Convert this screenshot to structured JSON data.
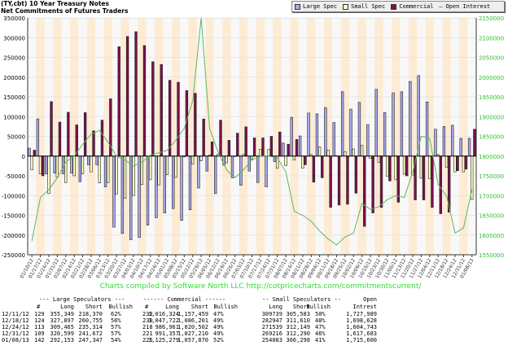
{
  "header": {
    "title": "(TY,cbt) 10 Year Treasury Notes",
    "subtitle": "Net Commitments of Futures Traders"
  },
  "legend": [
    {
      "label": "Large Spec",
      "color": "#aaaaee"
    },
    {
      "label": "Small Spec",
      "color": "#ffffc4"
    },
    {
      "label": "Commercial",
      "color": "#7a1050"
    },
    {
      "label": "Open Interest",
      "color": "#5cb85c"
    }
  ],
  "credit": "Charts compiled by Software North LLC  http://cotpricecharts.com/commitmentscurrent/",
  "chart_data": {
    "type": "bar",
    "title": "(TY,cbt) 10 Year Treasury Notes",
    "left_ylim": [
      -250000,
      350000
    ],
    "right_ylim": [
      1550000,
      2150000
    ],
    "left_ticks": [
      "350000",
      "300000",
      "250000",
      "200000",
      "150000",
      "100000",
      "50000",
      "0",
      "-50000",
      "-100000",
      "-150000",
      "-200000",
      "-250000"
    ],
    "right_ticks": [
      "2150000",
      "2100000",
      "2050000",
      "2000000",
      "1950000",
      "1900000",
      "1850000",
      "1800000",
      "1750000",
      "1700000",
      "1650000",
      "1600000",
      "1550000"
    ],
    "grid": true,
    "legend_placement": "top-right",
    "categories": [
      "01/10/12",
      "01/17/12",
      "01/24/12",
      "01/31/12",
      "02/07/12",
      "02/14/12",
      "02/21/12",
      "02/28/12",
      "03/06/12",
      "03/13/12",
      "03/20/12",
      "03/27/12",
      "04/03/12",
      "04/10/12",
      "04/17/12",
      "04/24/12",
      "05/01/12",
      "05/08/12",
      "05/15/12",
      "05/22/12",
      "05/29/12",
      "06/05/12",
      "06/12/12",
      "06/19/12",
      "06/26/12",
      "07/03/12",
      "07/10/12",
      "07/17/12",
      "07/24/12",
      "07/31/12",
      "08/07/12",
      "08/14/12",
      "08/21/12",
      "08/28/12",
      "09/04/12",
      "09/11/12",
      "09/18/12",
      "09/25/12",
      "10/02/12",
      "10/09/12",
      "10/16/12",
      "10/23/12",
      "10/30/12",
      "11/06/12",
      "11/13/12",
      "11/20/12",
      "11/27/12",
      "12/04/12",
      "12/11/12",
      "12/18/12",
      "12/24/12",
      "12/31/12",
      "01/08/13"
    ],
    "series": [
      {
        "name": "Large Spec",
        "axis": "left",
        "values": [
          20000,
          94000,
          -45000,
          -43000,
          -45000,
          -43000,
          -65000,
          -22000,
          -22000,
          -78000,
          -180000,
          -196000,
          -212000,
          -206000,
          -175000,
          -156000,
          -144000,
          -133000,
          -163000,
          -136000,
          -81000,
          -38000,
          -95000,
          -23000,
          -55000,
          -74000,
          -38000,
          -67000,
          -78000,
          -14000,
          33000,
          98000,
          51000,
          109000,
          107000,
          123000,
          85000,
          163000,
          119000,
          136000,
          80000,
          169000,
          110000,
          160000,
          163000,
          189000,
          204000,
          137000,
          68000,
          75000,
          78000,
          45000,
          45000
        ]
      },
      {
        "name": "Small Spec",
        "axis": "left",
        "values": [
          -35000,
          -45000,
          -95000,
          -53000,
          -67000,
          -50000,
          -45000,
          -40000,
          -68000,
          -67000,
          -96000,
          -107000,
          -100000,
          -72000,
          -60000,
          -73000,
          -47000,
          -54000,
          -2000,
          -20000,
          -12000,
          3000,
          5000,
          -17000,
          -1000,
          4000,
          -8000,
          17000,
          17000,
          -31000,
          -24000,
          -10000,
          -31000,
          4000,
          23000,
          15000,
          1000,
          11000,
          18000,
          27000,
          -6000,
          -16000,
          -51000,
          -60000,
          -46000,
          -48000,
          -56000,
          -57000,
          4000,
          -28000,
          -40000,
          -40000,
          -110000
        ]
      },
      {
        "name": "Commercial",
        "axis": "left",
        "values": [
          15000,
          -50000,
          138000,
          86000,
          111000,
          79000,
          110000,
          64000,
          91000,
          145000,
          277000,
          303000,
          315000,
          280000,
          239000,
          232000,
          192000,
          187000,
          166000,
          159000,
          94000,
          36000,
          91000,
          40000,
          58000,
          74000,
          46000,
          46000,
          50000,
          61000,
          30000,
          42000,
          -22000,
          -66000,
          -55000,
          -130000,
          -124000,
          -122000,
          -94000,
          -178000,
          -144000,
          -130000,
          -63000,
          -117000,
          -50000,
          -111000,
          -111000,
          -130000,
          -146000,
          -142000,
          -37000,
          -33000,
          68000
        ]
      },
      {
        "name": "Open Interest",
        "axis": "right",
        "type": "line",
        "values": [
          1585000,
          1695000,
          1715000,
          1745000,
          1785000,
          1800000,
          1830000,
          1855000,
          1865000,
          1835000,
          1800000,
          1790000,
          1775000,
          1785000,
          1803000,
          1808000,
          1815000,
          1840000,
          1870000,
          1940000,
          2150000,
          1870000,
          1810000,
          1765000,
          1745000,
          1765000,
          1790000,
          1800000,
          1800000,
          1795000,
          1760000,
          1660000,
          1650000,
          1635000,
          1610000,
          1590000,
          1575000,
          1595000,
          1605000,
          1680000,
          1665000,
          1672000,
          1690000,
          1700000,
          1695000,
          1760000,
          1850000,
          1845000,
          1728000,
          1699000,
          1605000,
          1618000,
          1716000
        ]
      }
    ]
  },
  "table": {
    "group_headers": [
      "--- Large Speculators ---",
      "------ Commercial ------",
      "-- Small Speculators --",
      "Open"
    ],
    "sub_headers": [
      "#",
      "Long",
      "Short",
      "Bullish",
      "#",
      "Long",
      "Short",
      "Bullish",
      "Long",
      "Short",
      "Bullish",
      "Intrest"
    ],
    "rows": [
      [
        "12/11/12",
        "129",
        "355,349",
        "218,370",
        "62%",
        "233",
        "1,016,324",
        "1,157,459",
        "47%",
        "309739",
        "305,583",
        "50%",
        "1,727,989"
      ],
      [
        "12/18/12",
        "124",
        "327,897",
        "260,755",
        "56%",
        "230",
        "1,047,722",
        "1,086,201",
        "49%",
        "282947",
        "311,610",
        "48%",
        "1,698,628"
      ],
      [
        "12/24/12",
        "113",
        "309,465",
        "235,314",
        "57%",
        "218",
        "986,961",
        "1,020,502",
        "49%",
        "271539",
        "312,149",
        "47%",
        "1,604,743"
      ],
      [
        "12/31/12",
        "109",
        "320,599",
        "241,672",
        "57%",
        "221",
        "991,357",
        "1,027,210",
        "49%",
        "269216",
        "312,290",
        "46%",
        "1,617,683"
      ],
      [
        "01/08/13",
        "142",
        "292,153",
        "247,347",
        "54%",
        "225",
        "1,125,279",
        "1,057,870",
        "52%",
        "254083",
        "366,298",
        "41%",
        "1,715,600"
      ]
    ]
  }
}
